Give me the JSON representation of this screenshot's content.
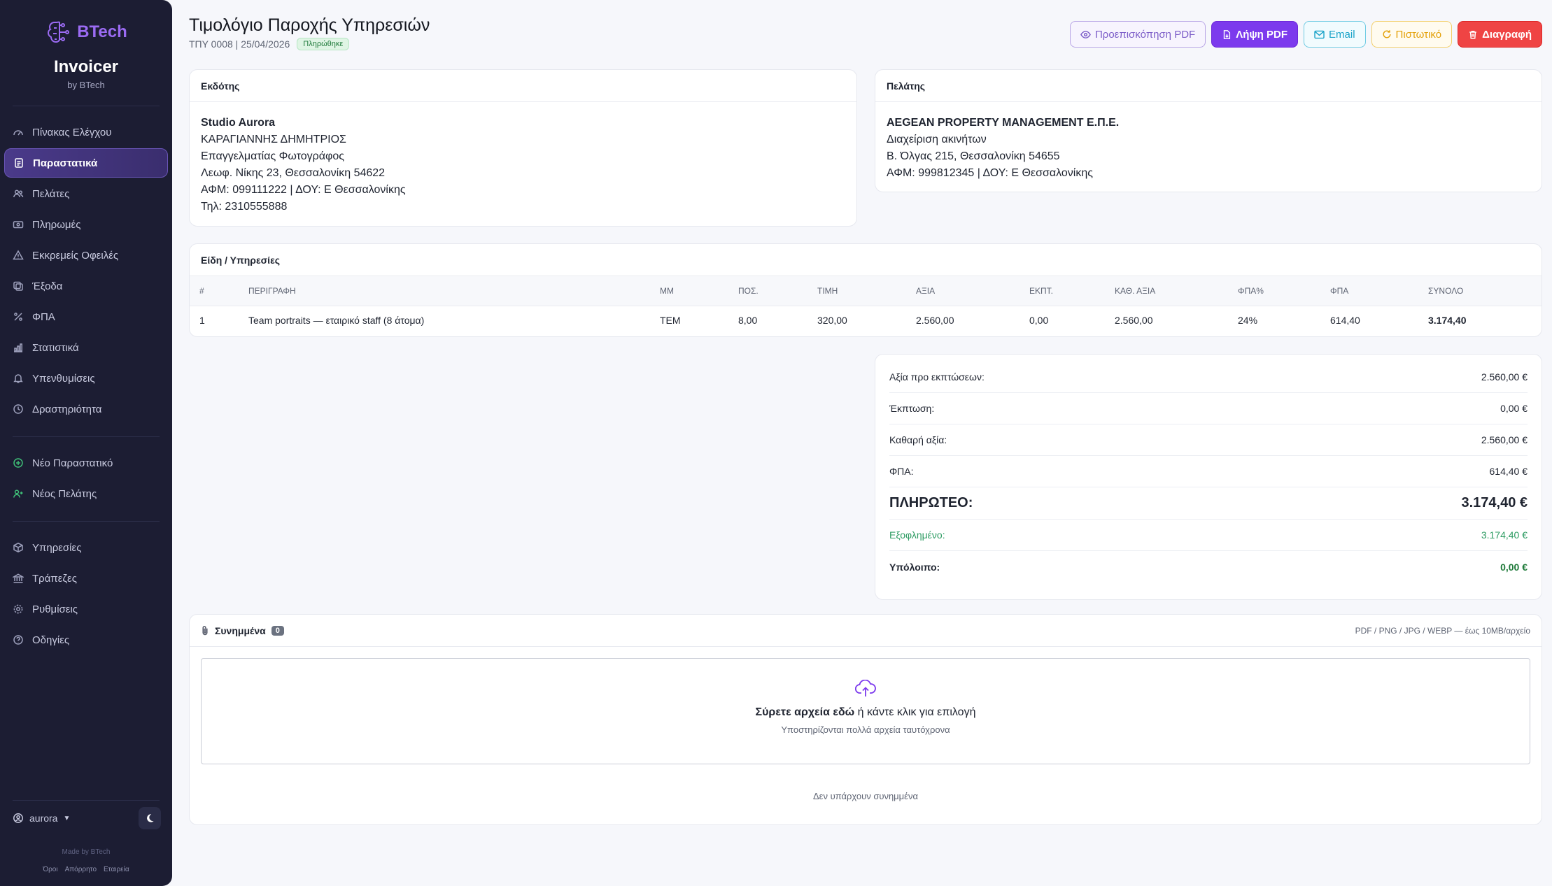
{
  "sidebar": {
    "brand_name": "BTech",
    "app_title": "Invoicer",
    "app_sub": "by BTech",
    "nav_main": [
      {
        "label": "Πίνακας Ελέγχου",
        "icon": "dashboard-icon"
      },
      {
        "label": "Παραστατικά",
        "icon": "document-icon",
        "active": true
      },
      {
        "label": "Πελάτες",
        "icon": "users-icon"
      },
      {
        "label": "Πληρωμές",
        "icon": "payments-icon"
      },
      {
        "label": "Εκκρεμείς Οφειλές",
        "icon": "warning-icon"
      },
      {
        "label": "Έξοδα",
        "icon": "expenses-icon"
      },
      {
        "label": "ΦΠΑ",
        "icon": "percent-icon"
      },
      {
        "label": "Στατιστικά",
        "icon": "stats-icon"
      },
      {
        "label": "Υπενθυμίσεις",
        "icon": "bell-icon"
      },
      {
        "label": "Δραστηριότητα",
        "icon": "clock-icon"
      }
    ],
    "nav_quick": [
      {
        "label": "Νέο Παραστατικό",
        "icon": "plus-circle-icon"
      },
      {
        "label": "Νέος Πελάτης",
        "icon": "user-plus-icon"
      }
    ],
    "nav_settings": [
      {
        "label": "Υπηρεσίες",
        "icon": "box-icon"
      },
      {
        "label": "Τράπεζες",
        "icon": "bank-icon"
      },
      {
        "label": "Ρυθμίσεις",
        "icon": "gear-icon"
      },
      {
        "label": "Οδηγίες",
        "icon": "help-icon"
      }
    ],
    "user": "aurora",
    "made_by": "Made by BTech",
    "footer_links": [
      "Όροι",
      "Απόρρητο",
      "Εταιρεία"
    ]
  },
  "header": {
    "title": "Τιμολόγιο Παροχής Υπηρεσιών",
    "meta": "ΤΠΥ 0008 | 25/04/2026",
    "status": "Πληρώθηκε",
    "actions": {
      "preview": "Προεπισκόπηση PDF",
      "download": "Λήψη PDF",
      "email": "Email",
      "credit": "Πιστωτικό",
      "delete": "Διαγραφή"
    }
  },
  "issuer": {
    "heading": "Εκδότης",
    "name": "Studio Aurora",
    "lines": [
      "ΚΑΡΑΓΙΑΝΝΗΣ ΔΗΜΗΤΡΙΟΣ",
      "Επαγγελματίας Φωτογράφος",
      "Λεωφ. Νίκης 23, Θεσσαλονίκη 54622",
      "ΑΦΜ: 099111222 | ΔΟΥ: Ε Θεσσαλονίκης",
      "Τηλ: 2310555888"
    ]
  },
  "client": {
    "heading": "Πελάτης",
    "name": "AEGEAN PROPERTY MANAGEMENT Ε.Π.Ε.",
    "lines": [
      "Διαχείριση ακινήτων",
      "Β. Όλγας 215, Θεσσαλονίκη 54655",
      "ΑΦΜ: 999812345 | ΔΟΥ: Ε Θεσσαλονίκης"
    ]
  },
  "items": {
    "heading": "Είδη / Υπηρεσίες",
    "columns": [
      "#",
      "ΠΕΡΙΓΡΑΦΗ",
      "ΜΜ",
      "ΠΟΣ.",
      "ΤΙΜΗ",
      "ΑΞΙΑ",
      "ΕΚΠΤ.",
      "ΚΑΘ. ΑΞΙΑ",
      "ΦΠΑ%",
      "ΦΠΑ",
      "ΣΥΝΟΛΟ"
    ],
    "rows": [
      [
        "1",
        "Team portraits — εταιρικό staff (8 άτομα)",
        "ΤΕΜ",
        "8,00",
        "320,00",
        "2.560,00",
        "0,00",
        "2.560,00",
        "24%",
        "614,40",
        "3.174,40"
      ]
    ]
  },
  "totals": [
    {
      "label": "Αξία προ εκπτώσεων:",
      "value": "2.560,00 €"
    },
    {
      "label": "Έκπτωση:",
      "value": "0,00 €"
    },
    {
      "label": "Καθαρή αξία:",
      "value": "2.560,00 €"
    },
    {
      "label": "ΦΠΑ:",
      "value": "614,40 €"
    },
    {
      "label": "ΠΛΗΡΩΤΕΟ:",
      "value": "3.174,40 €"
    },
    {
      "label": "Εξοφλημένο:",
      "value": "3.174,40 €"
    },
    {
      "label": "Υπόλοιπο:",
      "value": "0,00 €"
    }
  ],
  "attachments": {
    "heading": "Συνημμένα",
    "count": "0",
    "hint": "PDF / PNG / JPG / WEBP — έως 10MB/αρχείο",
    "drop_bold": "Σύρετε αρχεία εδώ",
    "drop_rest": " ή κάντε κλικ για επιλογή",
    "drop_sub": "Υποστηρίζονται πολλά αρχεία ταυτόχρονα",
    "empty": "Δεν υπάρχουν συνημμένα"
  },
  "colors": {
    "accent": "#7c3aed",
    "sidebar_bg": "#1c1d33",
    "danger": "#ef4444",
    "success": "#1f7a3a"
  }
}
